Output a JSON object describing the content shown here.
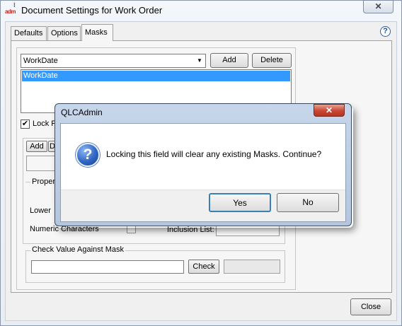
{
  "window": {
    "title": "Document Settings for Work Order",
    "logo_text": "adm",
    "close_glyph": "✕"
  },
  "tabs": [
    {
      "label": "Defaults"
    },
    {
      "label": "Options"
    },
    {
      "label": "Masks"
    }
  ],
  "help_glyph": "?",
  "masks": {
    "selected_mask": "WorkDate",
    "add_label": "Add",
    "delete_label": "Delete",
    "list_items": [
      "WorkDate"
    ],
    "lock_checked_glyph": "✔",
    "lock_label": "Lock F"
  },
  "sub_panel": {
    "add_label": "Add",
    "d_label": "D",
    "properties_label": "Proper",
    "lower_label": "Lower",
    "numeric_label": "Numeric Characters",
    "inclusion_label": "Inclusion List:"
  },
  "check": {
    "group_label": "Check Value Against Mask",
    "input_value": "",
    "button_label": "Check"
  },
  "close_label": "Close",
  "dialog": {
    "title": "QLCAdmin",
    "close_glyph": "✕",
    "icon_glyph": "?",
    "message": "Locking this field will clear any existing Masks. Continue?",
    "yes_label": "Yes",
    "no_label": "No"
  }
}
